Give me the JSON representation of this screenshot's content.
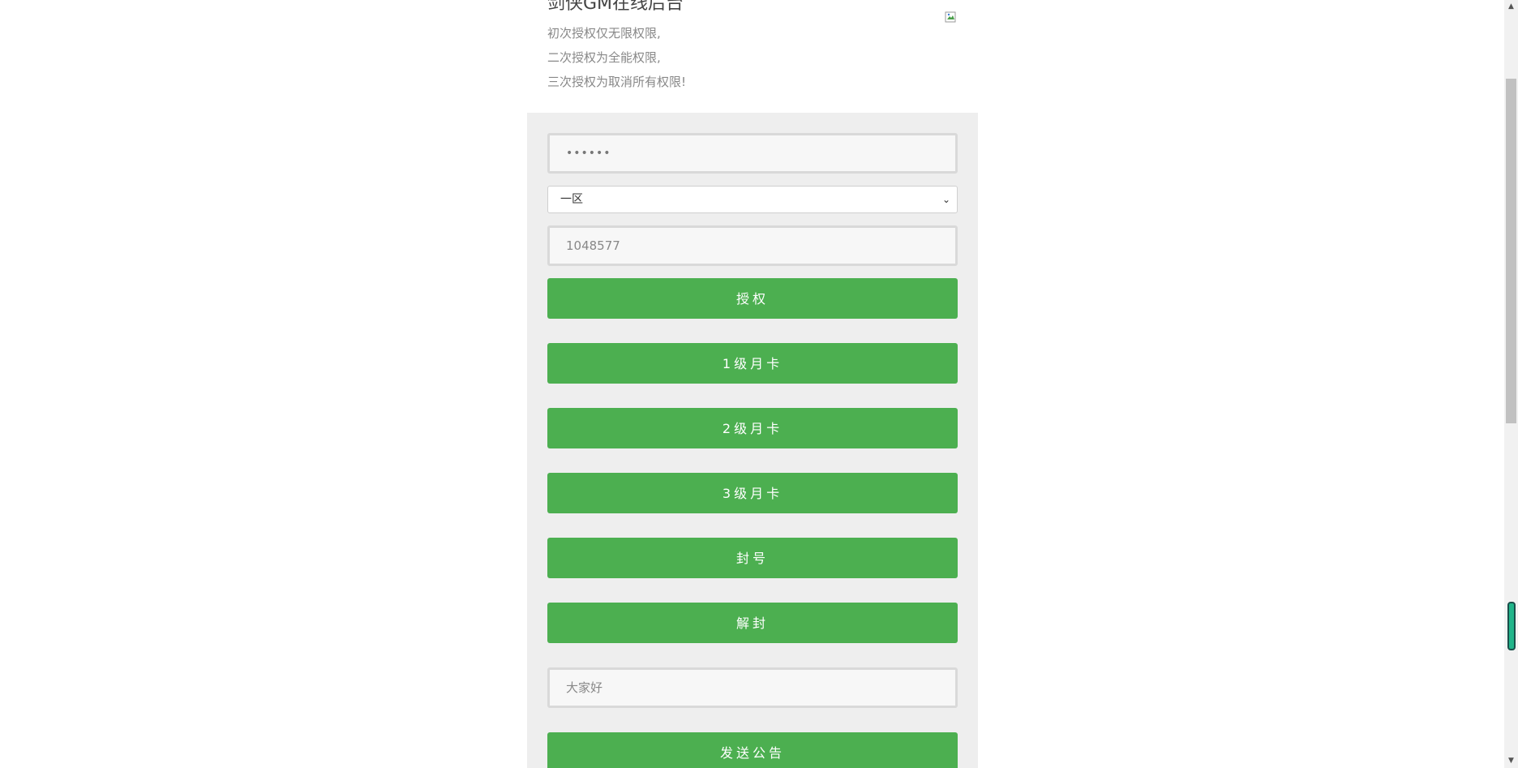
{
  "header": {
    "title": "剑侠GM在线后台",
    "notices": [
      "初次授权仅无限权限,",
      "二次授权为全能权限,",
      "三次授权为取消所有权限!"
    ]
  },
  "form": {
    "password_value": "••••••",
    "server_select": {
      "selected": "一区"
    },
    "player_id_placeholder": "1048577",
    "authorize_label": "授权",
    "monthly_card_1_label": "1级月卡",
    "monthly_card_2_label": "2级月卡",
    "monthly_card_3_label": "3级月卡",
    "ban_label": "封号",
    "unban_label": "解封",
    "announcement_placeholder": "大家好",
    "send_announcement_label": "发送公告"
  },
  "colors": {
    "accent": "#4caf50",
    "panel_background": "#eeeeee"
  }
}
